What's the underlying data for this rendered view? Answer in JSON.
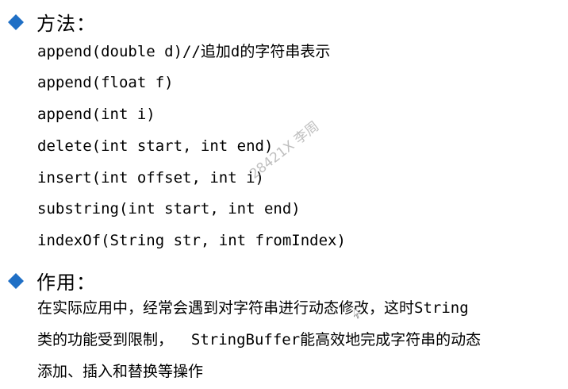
{
  "methods": {
    "heading": "方法：",
    "lines": [
      "append(double d)//追加d的字符串表示",
      "append(float f)",
      "append(int i)",
      "delete(int start, int end)",
      "insert(int offset, int i)",
      "substring(int start, int end)",
      "indexOf(String str, int fromIndex)"
    ]
  },
  "usage": {
    "heading": "作用：",
    "lines": [
      "在实际应用中，经常会遇到对字符串进行动态修改，这时String",
      "类的功能受到限制，  StringBuffer能高效地完成字符串的动态",
      "添加、插入和替换等操作"
    ]
  },
  "watermark": "28421X 李周",
  "colors": {
    "bullet": "#1f6fc5",
    "watermark": "#b5b5b5"
  }
}
